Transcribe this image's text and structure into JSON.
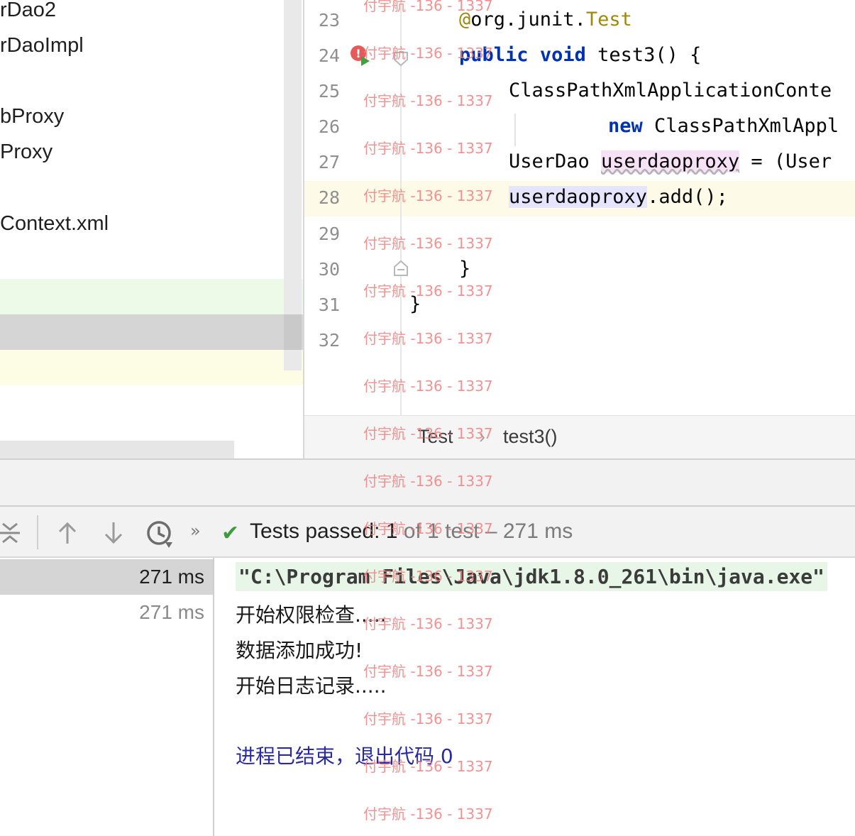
{
  "project_tree": {
    "items": [
      "rDao2",
      "rDaoImpl",
      "bProxy",
      "Proxy",
      "Context.xml"
    ]
  },
  "editor": {
    "line_numbers": [
      "23",
      "24",
      "25",
      "26",
      "27",
      "28",
      "29",
      "30",
      "31",
      "32"
    ],
    "lines": {
      "l23_at": "@",
      "l23_pkg": "org.junit.",
      "l23_ann": "Test",
      "l24_kw1": "public",
      "l24_kw2": "void",
      "l24_rest": " test3() {",
      "l25": "ClassPathXmlApplicationConte",
      "l26_kw": "new",
      "l26_rest": " ClassPathXmlAppl",
      "l27_type": "UserDao ",
      "l27_var": "userdaoproxy",
      "l27_rest": " = (User",
      "l28_ref": "userdaoproxy",
      "l28_rest": ".add();",
      "l30": "}",
      "l31": "}"
    },
    "breadcrumb": [
      "Test",
      "test3()"
    ],
    "breadcrumb_sep": "›"
  },
  "run_toolbar": {
    "icons": [
      "collapse-icon",
      "arrow-up-icon",
      "arrow-down-icon",
      "history-clock-icon",
      "more-chevron-icon"
    ],
    "status_main": "Tests passed: 1",
    "status_sub": " of 1 test – 271 ms"
  },
  "test_tree": {
    "rows": [
      {
        "time": "271 ms",
        "selected": true
      },
      {
        "time": "271 ms",
        "selected": false
      }
    ]
  },
  "console": {
    "command": "\"C:\\Program Files\\Java\\jdk1.8.0_261\\bin\\java.exe\"",
    "lines": [
      "开始权限检查.....",
      "数据添加成功!",
      "开始日志记录....."
    ],
    "exit": "进程已结束，退出代码 0"
  },
  "watermark": {
    "text": "付宇航 -136 - 1337"
  },
  "colors": {
    "keyword": "#0033b3",
    "annotation": "#9e880d",
    "pass_green": "#3e9c3e",
    "exit_blue": "#2a2aa0",
    "watermark": "#f08080"
  }
}
